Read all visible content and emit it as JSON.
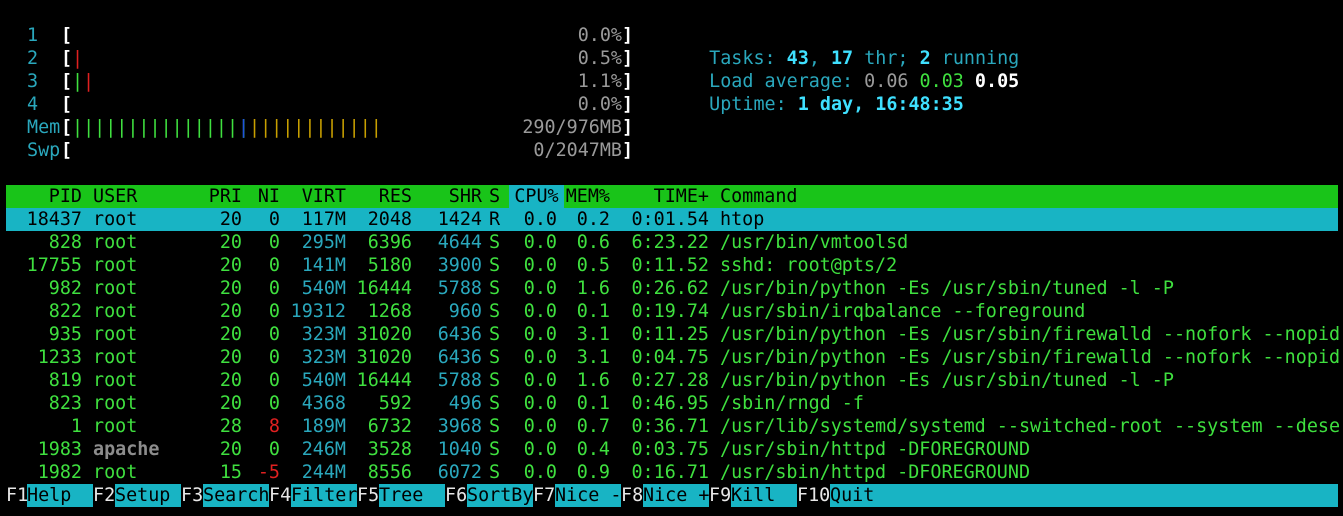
{
  "cpu_meters": [
    {
      "label": "1",
      "value": "0.0%",
      "level_percent": 0.0
    },
    {
      "label": "2",
      "value": "0.5%",
      "level_percent": 0.5
    },
    {
      "label": "3",
      "value": "1.1%",
      "level_percent": 1.1
    },
    {
      "label": "4",
      "value": "0.0%",
      "level_percent": 0.0
    }
  ],
  "mem_meter": {
    "label": "Mem",
    "value": "290/976MB"
  },
  "swp_meter": {
    "label": "Swp",
    "value": "0/2047MB"
  },
  "summary": {
    "tasks_label": "Tasks:",
    "tasks": "43",
    "thr": "17",
    "thr_label": "thr;",
    "running": "2",
    "running_label": "running",
    "load_label": "Load average:",
    "load1": "0.06",
    "load5": "0.03",
    "load15": "0.05",
    "uptime_label": "Uptime:",
    "uptime": "1 day, 16:48:35"
  },
  "columns": {
    "pid": "PID",
    "user": "USER",
    "pri": "PRI",
    "ni": "NI",
    "virt": "VIRT",
    "res": "RES",
    "shr": "SHR",
    "s": "S",
    "cpu": "CPU%",
    "mem": "MEM%",
    "time": "TIME+",
    "command": "Command"
  },
  "processes": [
    {
      "pid": "18437",
      "user": "root",
      "pri": "20",
      "ni": "0",
      "virt": "117M",
      "res": "2048",
      "shr": "1424",
      "s": "R",
      "cpu": "0.0",
      "mem": "0.2",
      "time": "0:01.54",
      "command": "htop"
    },
    {
      "pid": "828",
      "user": "root",
      "pri": "20",
      "ni": "0",
      "virt": "295M",
      "res": "6396",
      "shr": "4644",
      "s": "S",
      "cpu": "0.0",
      "mem": "0.6",
      "time": "6:23.22",
      "command": "/usr/bin/vmtoolsd"
    },
    {
      "pid": "17755",
      "user": "root",
      "pri": "20",
      "ni": "0",
      "virt": "141M",
      "res": "5180",
      "shr": "3900",
      "s": "S",
      "cpu": "0.0",
      "mem": "0.5",
      "time": "0:11.52",
      "command": "sshd: root@pts/2"
    },
    {
      "pid": "982",
      "user": "root",
      "pri": "20",
      "ni": "0",
      "virt": "540M",
      "res": "16444",
      "shr": "5788",
      "s": "S",
      "cpu": "0.0",
      "mem": "1.6",
      "time": "0:26.62",
      "command": "/usr/bin/python -Es /usr/sbin/tuned -l -P"
    },
    {
      "pid": "822",
      "user": "root",
      "pri": "20",
      "ni": "0",
      "virt": "19312",
      "res": "1268",
      "shr": "960",
      "s": "S",
      "cpu": "0.0",
      "mem": "0.1",
      "time": "0:19.74",
      "command": "/usr/sbin/irqbalance --foreground"
    },
    {
      "pid": "935",
      "user": "root",
      "pri": "20",
      "ni": "0",
      "virt": "323M",
      "res": "31020",
      "shr": "6436",
      "s": "S",
      "cpu": "0.0",
      "mem": "3.1",
      "time": "0:11.25",
      "command": "/usr/bin/python -Es /usr/sbin/firewalld --nofork --nopid"
    },
    {
      "pid": "1233",
      "user": "root",
      "pri": "20",
      "ni": "0",
      "virt": "323M",
      "res": "31020",
      "shr": "6436",
      "s": "S",
      "cpu": "0.0",
      "mem": "3.1",
      "time": "0:04.75",
      "command": "/usr/bin/python -Es /usr/sbin/firewalld --nofork --nopid"
    },
    {
      "pid": "819",
      "user": "root",
      "pri": "20",
      "ni": "0",
      "virt": "540M",
      "res": "16444",
      "shr": "5788",
      "s": "S",
      "cpu": "0.0",
      "mem": "1.6",
      "time": "0:27.28",
      "command": "/usr/bin/python -Es /usr/sbin/tuned -l -P"
    },
    {
      "pid": "823",
      "user": "root",
      "pri": "20",
      "ni": "0",
      "virt": "4368",
      "res": "592",
      "shr": "496",
      "s": "S",
      "cpu": "0.0",
      "mem": "0.1",
      "time": "0:46.95",
      "command": "/sbin/rngd -f"
    },
    {
      "pid": "1",
      "user": "root",
      "pri": "28",
      "ni": "8",
      "virt": "189M",
      "res": "6732",
      "shr": "3968",
      "s": "S",
      "cpu": "0.0",
      "mem": "0.7",
      "time": "0:36.71",
      "command": "/usr/lib/systemd/systemd --switched-root --system --dese"
    },
    {
      "pid": "1983",
      "user": "apache",
      "pri": "20",
      "ni": "0",
      "virt": "246M",
      "res": "3528",
      "shr": "1040",
      "s": "S",
      "cpu": "0.0",
      "mem": "0.4",
      "time": "0:03.75",
      "command": "/usr/sbin/httpd -DFOREGROUND"
    },
    {
      "pid": "1982",
      "user": "root",
      "pri": "15",
      "ni": "-5",
      "virt": "244M",
      "res": "8556",
      "shr": "6072",
      "s": "S",
      "cpu": "0.0",
      "mem": "0.9",
      "time": "0:16.71",
      "command": "/usr/sbin/httpd -DFOREGROUND"
    }
  ],
  "function_keys": [
    {
      "key": "F1",
      "label": "Help"
    },
    {
      "key": "F2",
      "label": "Setup"
    },
    {
      "key": "F3",
      "label": "Search"
    },
    {
      "key": "F4",
      "label": "Filter"
    },
    {
      "key": "F5",
      "label": "Tree"
    },
    {
      "key": "F6",
      "label": "SortBy"
    },
    {
      "key": "F7",
      "label": "Nice -"
    },
    {
      "key": "F8",
      "label": "Nice +"
    },
    {
      "key": "F9",
      "label": "Kill"
    },
    {
      "key": "F10",
      "label": "Quit"
    }
  ],
  "colors": {
    "header_bg": "#19c419",
    "selected_bg": "#18b4c4",
    "cyan": "#2aa8bd",
    "green": "#3fe03f"
  }
}
